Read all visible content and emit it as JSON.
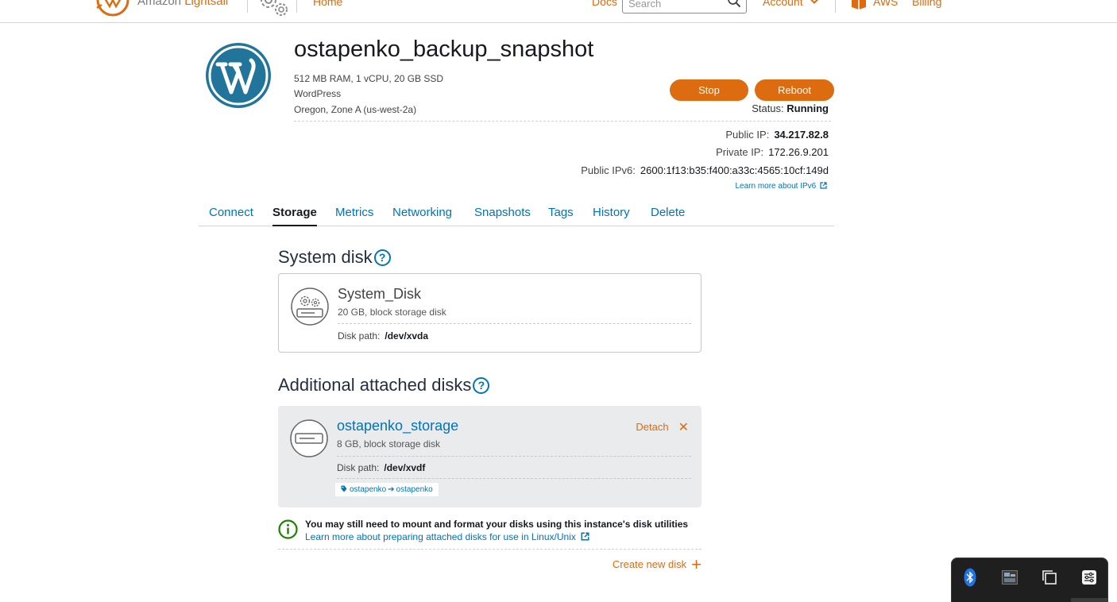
{
  "topbar": {
    "brand_prefix": "Amazon ",
    "brand_name": "Lightsail",
    "home_label": "Home",
    "docs_label": "Docs",
    "search_placeholder": "Search",
    "account_label": "Account",
    "aws_label": "AWS",
    "billing_label": "Billing"
  },
  "instance": {
    "name": "ostapenko_backup_snapshot",
    "specs": "512 MB RAM, 1 vCPU, 20 GB SSD",
    "blueprint": "WordPress",
    "location": "Oregon, Zone A (us-west-2a)",
    "stop_label": "Stop",
    "reboot_label": "Reboot",
    "status_label": "Status:",
    "status_value": "Running",
    "public_ip_label": "Public IP:",
    "public_ip": "34.217.82.8",
    "private_ip_label": "Private IP:",
    "private_ip": "172.26.9.201",
    "ipv6_label": "Public IPv6:",
    "ipv6": "2600:1f13:b35:f400:a33c:4565:10cf:149d",
    "ipv6_learn_more": "Learn more about IPv6"
  },
  "tabs": [
    "Connect",
    "Storage",
    "Metrics",
    "Networking",
    "Snapshots",
    "Tags",
    "History",
    "Delete"
  ],
  "active_tab": "Storage",
  "system_disk": {
    "heading": "System disk",
    "name": "System_Disk",
    "description": "20 GB, block storage disk",
    "path_label": "Disk path:",
    "path": "/dev/xvda"
  },
  "attached": {
    "heading": "Additional attached disks",
    "disks": [
      {
        "name": "ostapenko_storage",
        "description": "8 GB, block storage disk",
        "path_label": "Disk path:",
        "path": "/dev/xvdf",
        "detach_label": "Detach",
        "tag_key": "ostapenko",
        "tag_value": "ostapenko"
      }
    ]
  },
  "notice": {
    "text": "You may still need to mount and format your disks using this instance's disk utilities",
    "link": "Learn more about preparing attached disks for use in Linux/Unix"
  },
  "create_disk_label": "Create new disk",
  "colors": {
    "accent_orange": "#dd6b10",
    "link_blue": "#0073bb",
    "wordpress_blue": "#21759b",
    "info_green": "#1d8102"
  },
  "tray": {
    "icons": [
      "bluetooth-icon",
      "display-icon",
      "copy-window-icon",
      "settings-panel-icon"
    ]
  }
}
